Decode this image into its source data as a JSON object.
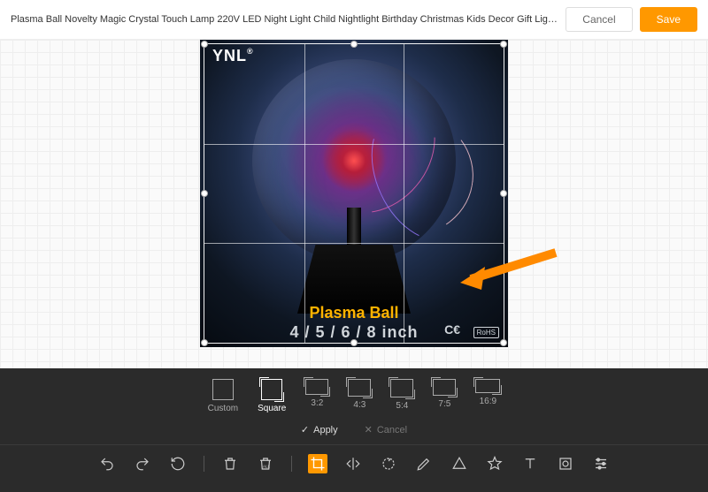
{
  "header": {
    "title": "Plasma Ball Novelty Magic Crystal Touch Lamp 220V LED Night Light Child Nightlight Birthday Christmas Kids Decor Gift Lighting",
    "cancel": "Cancel",
    "save": "Save"
  },
  "image": {
    "logo": "YNL",
    "registered": "®",
    "line1": "Plasma Ball",
    "line2": "4 / 5 / 6 / 8 inch",
    "ce": "C€",
    "rohs": "RoHS"
  },
  "ratios": [
    {
      "label": "Custom",
      "active": false
    },
    {
      "label": "Square",
      "active": true
    },
    {
      "label": "3:2",
      "active": false
    },
    {
      "label": "4:3",
      "active": false
    },
    {
      "label": "5:4",
      "active": false
    },
    {
      "label": "7:5",
      "active": false
    },
    {
      "label": "16:9",
      "active": false
    }
  ],
  "actions": {
    "apply": "Apply",
    "cancel": "Cancel"
  },
  "tools": {
    "undo": "undo",
    "redo": "redo",
    "reset": "reset",
    "delete": "delete",
    "delete_all": "delete-all",
    "crop": "crop",
    "flip": "flip",
    "rotate": "rotate",
    "draw": "draw",
    "shape": "shape",
    "icon": "icon",
    "text": "text",
    "mask": "mask",
    "filter": "filter"
  },
  "colors": {
    "accent": "#ff9800"
  }
}
